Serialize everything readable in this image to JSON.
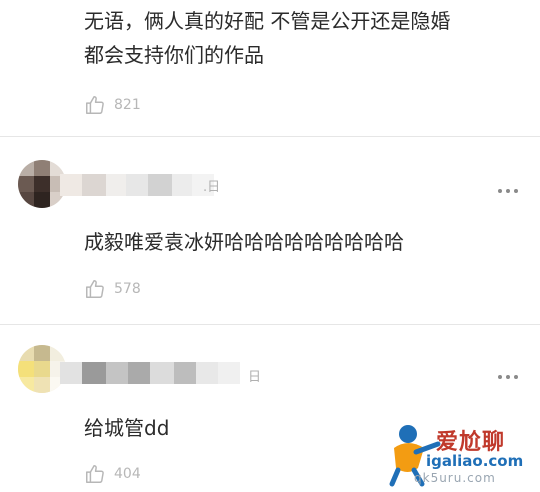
{
  "comments": [
    {
      "text": "无语，俩人真的好配 不管是公开还是隐婚\n都会支持你们的作品",
      "likes": "821",
      "icon": "thumbs-up-icon"
    },
    {
      "user_suffix": ".日",
      "text": "成毅唯爱袁冰妍哈哈哈哈哈哈哈哈哈",
      "likes": "578",
      "icon": "thumbs-up-icon"
    },
    {
      "user_suffix": "日",
      "text": "给城管dd",
      "likes": "404",
      "icon": "thumbs-up-icon"
    }
  ],
  "watermark": {
    "brand": "爱尬聊",
    "url": "igaliao.com",
    "sub": "qk5uru.com"
  },
  "colors": {
    "like_gray": "#b7b7b7",
    "divider": "#e6e6e6",
    "watermark_red": "#c0392b",
    "watermark_blue": "#1f6fb7"
  }
}
